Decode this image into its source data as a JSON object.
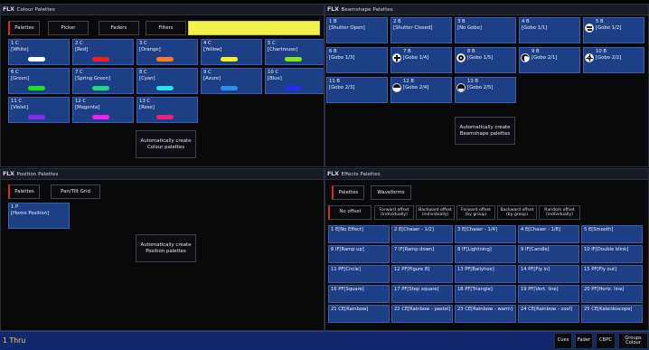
{
  "colour_panel": {
    "title_prefix": "FLX",
    "title": "Colour Palettes",
    "tabs": [
      "Palettes",
      "Picker",
      "Faders",
      "Filters"
    ],
    "tiles": [
      {
        "num": "1 C",
        "name": "[White]",
        "color": "#ffffff"
      },
      {
        "num": "2 C",
        "name": "[Red]",
        "color": "#ff1a1a"
      },
      {
        "num": "3 C",
        "name": "[Orange]",
        "color": "#ff7a1a"
      },
      {
        "num": "4 C",
        "name": "[Yellow]",
        "color": "#f3f320"
      },
      {
        "num": "5 C",
        "name": "[Chartreuse]",
        "color": "#86e61a"
      },
      {
        "num": "6 C",
        "name": "[Green]",
        "color": "#1fe01f"
      },
      {
        "num": "7 C",
        "name": "[Spring Green]",
        "color": "#1fd886"
      },
      {
        "num": "8 C",
        "name": "[Cyan]",
        "color": "#20e6ee"
      },
      {
        "num": "9 C",
        "name": "[Azure]",
        "color": "#2e8ef0"
      },
      {
        "num": "10 C",
        "name": "[Blue]",
        "color": "#2a2af2"
      },
      {
        "num": "11 C",
        "name": "[Violet]",
        "color": "#8a2af0"
      },
      {
        "num": "12 C",
        "name": "[Magenta]",
        "color": "#f020f0"
      },
      {
        "num": "13 C",
        "name": "[Rose]",
        "color": "#f01f7a"
      }
    ],
    "auto_label": "Automatically create\nColour palettes"
  },
  "beam_panel": {
    "title_prefix": "FLX",
    "title": "Beamshape Palettes",
    "tiles": [
      {
        "num": "1 B",
        "name": "[Shutter Open]",
        "gobo": ""
      },
      {
        "num": "2 B",
        "name": "[Shutter Closed]",
        "gobo": ""
      },
      {
        "num": "3 B",
        "name": "[No Gobo]",
        "gobo": ""
      },
      {
        "num": "4 B",
        "name": "[Gobo 1/1]",
        "gobo": ""
      },
      {
        "num": "5 B",
        "name": "[Gobo 1/2]",
        "gobo": "gobo-dots-icon"
      },
      {
        "num": "6 B",
        "name": "[Gobo 1/3]",
        "gobo": ""
      },
      {
        "num": "7 B",
        "name": "[Gobo 1/4]",
        "gobo": "gobo-slot-icon"
      },
      {
        "num": "8 B",
        "name": "[Gobo 1/5]",
        "gobo": "gobo-ring-icon"
      },
      {
        "num": "9 B",
        "name": "[Gobo 2/1]",
        "gobo": "gobo-spiral-icon"
      },
      {
        "num": "10 B",
        "name": "[Gobo 2/2]",
        "gobo": "gobo-rays-icon"
      },
      {
        "num": "11 B",
        "name": "[Gobo 2/3]",
        "gobo": ""
      },
      {
        "num": "12 B",
        "name": "[Gobo 2/4]",
        "gobo": "gobo-half-icon"
      },
      {
        "num": "13 B",
        "name": "[Gobo 2/5]",
        "gobo": "gobo-dark-icon"
      }
    ],
    "auto_label": "Automatically create\nBeamshape palettes"
  },
  "position_panel": {
    "title_prefix": "FLX",
    "title": "Position Palettes",
    "tabs": [
      "Palettes",
      "Pan/Tilt Grid"
    ],
    "tiles": [
      {
        "num": "1 P",
        "name": "[Home Position]"
      }
    ],
    "auto_label": "Automatically create\nPosition palettes"
  },
  "effects_panel": {
    "title_prefix": "FLX",
    "title": "Effects Palettes",
    "tabs": [
      "Palettes",
      "Waveforms"
    ],
    "offsets": [
      "No offset",
      "Forward offset\n(individually)",
      "Backward offset\n(individually)",
      "Forward offset\n(by group)",
      "Backward offset\n(by group)",
      "Random offset\n(individually)"
    ],
    "tiles": [
      {
        "num": "1 E",
        "name": "[No Effect]"
      },
      {
        "num": "2 E",
        "name": "[Chaser - 1/2]"
      },
      {
        "num": "3 E",
        "name": "[Chaser - 1/4]"
      },
      {
        "num": "4 E",
        "name": "[Chaser - 1/8]"
      },
      {
        "num": "5 E",
        "name": "[Smooth]"
      },
      {
        "num": "6 IF",
        "name": "[Ramp up]"
      },
      {
        "num": "7 IF",
        "name": "[Ramp down]"
      },
      {
        "num": "8 IF",
        "name": "[Lightning]"
      },
      {
        "num": "9 IF",
        "name": "[Candle]"
      },
      {
        "num": "10 IF",
        "name": "[Double blink]"
      },
      {
        "num": "11 PF",
        "name": "[Circle]"
      },
      {
        "num": "12 PF",
        "name": "[Figure 8]"
      },
      {
        "num": "13 PF",
        "name": "[Ballyhoo]"
      },
      {
        "num": "14 PF",
        "name": "[Fly in]"
      },
      {
        "num": "15 PF",
        "name": "[Fly out]"
      },
      {
        "num": "16 PF",
        "name": "[Square]"
      },
      {
        "num": "17 PF",
        "name": "[Step square]"
      },
      {
        "num": "18 PF",
        "name": "[Triangle]"
      },
      {
        "num": "19 PF",
        "name": "[Vert. line]"
      },
      {
        "num": "20 PF",
        "name": "[Horiz. line]"
      },
      {
        "num": "21 CE",
        "name": "[Rainbow]"
      },
      {
        "num": "22 CE",
        "name": "[Rainbow - pastel]"
      },
      {
        "num": "23 CE",
        "name": "[Rainbow - warm]"
      },
      {
        "num": "24 CE",
        "name": "[Rainbow - cool]"
      },
      {
        "num": "25 CE",
        "name": "[Kaleidoscope]"
      }
    ]
  },
  "command_line": {
    "text": "1 Thru"
  },
  "quick_buttons": [
    "Cues",
    "Fader",
    "CBPC",
    "Groups\nColour"
  ],
  "colors": {
    "accent_yellow": "#f2f24a",
    "tile_blue": "#1d3f85",
    "cmd_blue": "#10286d",
    "active_red": "#d42b2b"
  }
}
